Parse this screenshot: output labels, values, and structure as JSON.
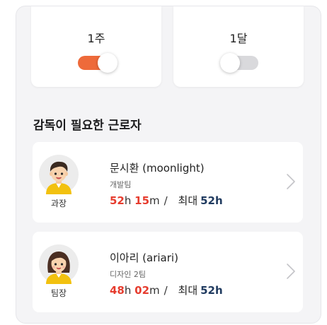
{
  "toggles": [
    {
      "label": "1주",
      "on": true
    },
    {
      "label": "1달",
      "on": false
    }
  ],
  "section": {
    "title": "감독이 필요한 근로자"
  },
  "workers": [
    {
      "name": "문시환 (moonlight)",
      "team": "개발팀",
      "rank": "과장",
      "hours_value": "52",
      "hours_unit": "h",
      "minutes_value": "15",
      "minutes_unit": "m",
      "separator": "/",
      "max_label": "최대",
      "max_value": "52h",
      "avatar": "male-avatar-icon"
    },
    {
      "name": "이아리 (ariari)",
      "team": "디자인 2팀",
      "rank": "팀장",
      "hours_value": "48",
      "hours_unit": "h",
      "minutes_value": "02",
      "minutes_unit": "m",
      "separator": "/",
      "max_label": "최대",
      "max_value": "52h",
      "avatar": "female-avatar-icon"
    }
  ],
  "colors": {
    "accent": "#ee6a3a",
    "overtime": "#e63c2e",
    "max": "#1f3a5f"
  }
}
